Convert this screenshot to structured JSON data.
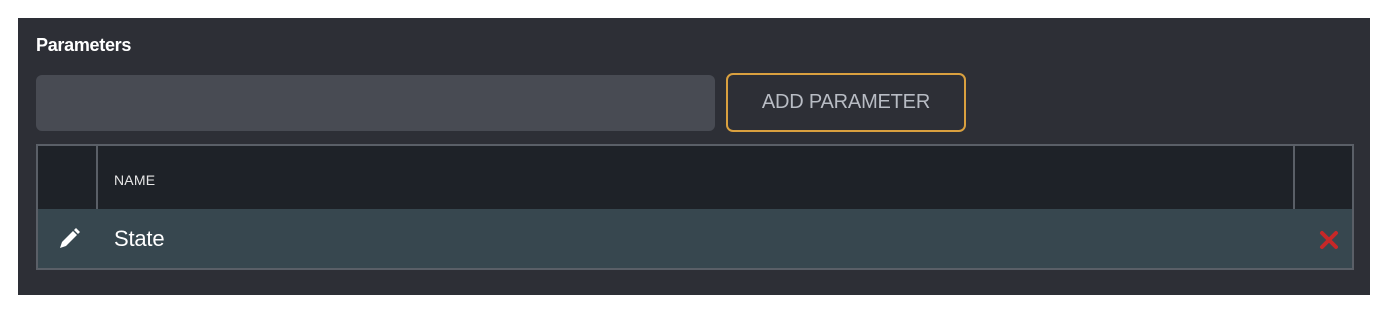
{
  "parameters": {
    "title": "Parameters",
    "input": {
      "value": "",
      "placeholder": ""
    },
    "add_button_label": "ADD PARAMETER",
    "table": {
      "columns": [
        "",
        "NAME",
        ""
      ],
      "rows": [
        {
          "name": "State"
        }
      ]
    }
  },
  "colors": {
    "panel_background": "#2d2f36",
    "row_background": "#37474f",
    "button_border": "#d9a03f",
    "delete_icon": "#c62828"
  },
  "icons": {
    "edit": "pencil-icon",
    "delete": "close-icon"
  }
}
